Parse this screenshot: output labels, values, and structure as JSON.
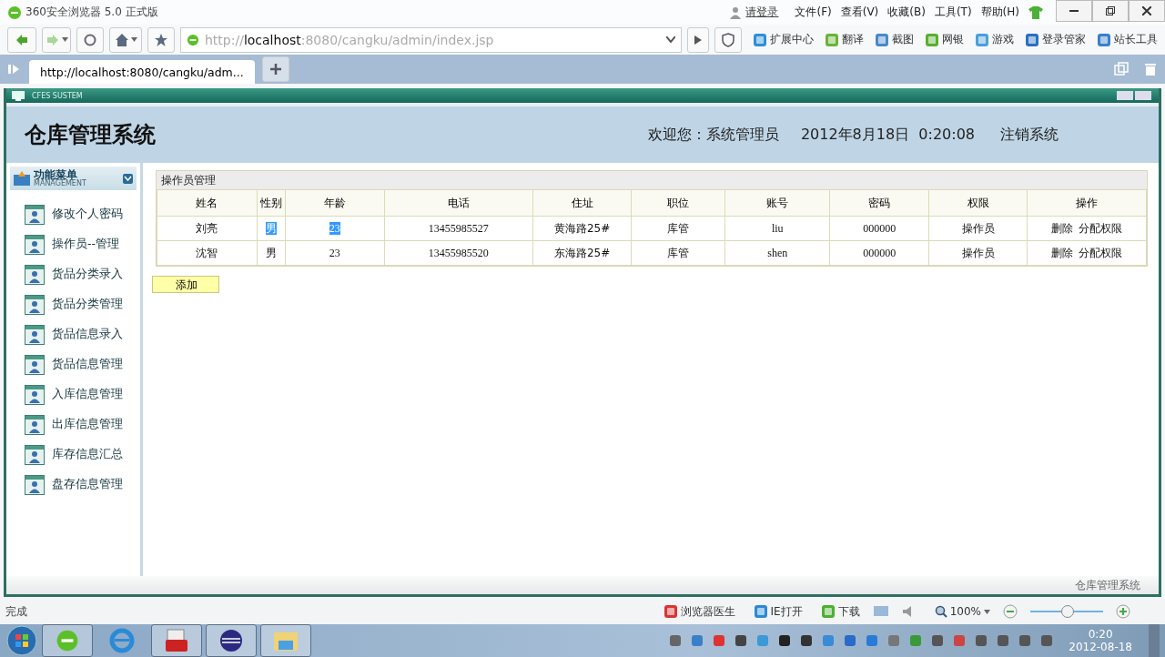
{
  "browser": {
    "title": "360安全浏览器 5.0 正式版",
    "login": "请登录",
    "menus": [
      "文件(F)",
      "查看(V)",
      "收藏(B)",
      "工具(T)",
      "帮助(H)"
    ],
    "url": {
      "scheme": "http://",
      "host": "localhost",
      "path": ":8080/cangku/admin/index.jsp"
    },
    "toolbar_items": [
      {
        "label": "扩展中心",
        "color": "#2f8fd8"
      },
      {
        "label": "翻译",
        "color": "#6bb33a"
      },
      {
        "label": "截图",
        "color": "#4a88c8"
      },
      {
        "label": "网银",
        "color": "#58b030"
      },
      {
        "label": "游戏",
        "color": "#4aa0d8"
      },
      {
        "label": "登录管家",
        "color": "#2a6fc0"
      },
      {
        "label": "站长工具",
        "color": "#3a80c8"
      }
    ],
    "tabs": [
      {
        "label": "http://localhost:8080/cangku/adm...",
        "selected": true
      }
    ]
  },
  "app": {
    "frame_title": "CFES SUSTEM",
    "title": "仓库管理系统",
    "welcome": "欢迎您：系统管理员",
    "datetime": "2012年8月18日  0:20:08",
    "logout": "注销系统",
    "menu_title": "功能菜单",
    "menu_subtitle": "MANAGEMENT",
    "menu_items": [
      "修改个人密码",
      "操作员--管理",
      "货品分类录入",
      "货品分类管理",
      "货品信息录入",
      "货品信息管理",
      "入库信息管理",
      "出库信息管理",
      "库存信息汇总",
      "盘存信息管理"
    ],
    "panel_title": "操作员管理",
    "table": {
      "columns": [
        "姓名",
        "性别",
        "年龄",
        "电话",
        "住址",
        "职位",
        "账号",
        "密码",
        "权限",
        "操作"
      ],
      "rows": [
        {
          "cells": [
            {
              "text": "刘亮",
              "highlighted": false
            },
            {
              "text": "男",
              "highlighted": true
            },
            {
              "text": "23",
              "highlighted": true
            },
            {
              "text": "13455985527",
              "highlighted": false
            },
            {
              "text": "黄海路25#",
              "highlighted": false
            },
            {
              "text": "库管",
              "highlighted": false
            },
            {
              "text": "liu",
              "highlighted": false
            },
            {
              "text": "000000",
              "highlighted": false
            },
            {
              "text": "操作员",
              "highlighted": false
            }
          ],
          "actions": [
            "删除",
            "分配权限"
          ]
        },
        {
          "cells": [
            {
              "text": "沈智",
              "highlighted": false
            },
            {
              "text": "男",
              "highlighted": false
            },
            {
              "text": "23",
              "highlighted": false
            },
            {
              "text": "13455985520",
              "highlighted": false
            },
            {
              "text": "东海路25#",
              "highlighted": false
            },
            {
              "text": "库管",
              "highlighted": false
            },
            {
              "text": "shen",
              "highlighted": false
            },
            {
              "text": "000000",
              "highlighted": false
            },
            {
              "text": "操作员",
              "highlighted": false
            }
          ],
          "actions": [
            "删除",
            "分配权限"
          ]
        }
      ]
    },
    "add_button": "添加",
    "footer": "仓库管理系统"
  },
  "status_bar": {
    "text": "完成",
    "items": [
      "浏览器医生",
      "IE打开",
      "下载"
    ],
    "zoom": "100%",
    "zoom_slider": {
      "level": 0.5
    }
  },
  "taskbar": {
    "time": "0:20",
    "date": "2012-08-18"
  }
}
